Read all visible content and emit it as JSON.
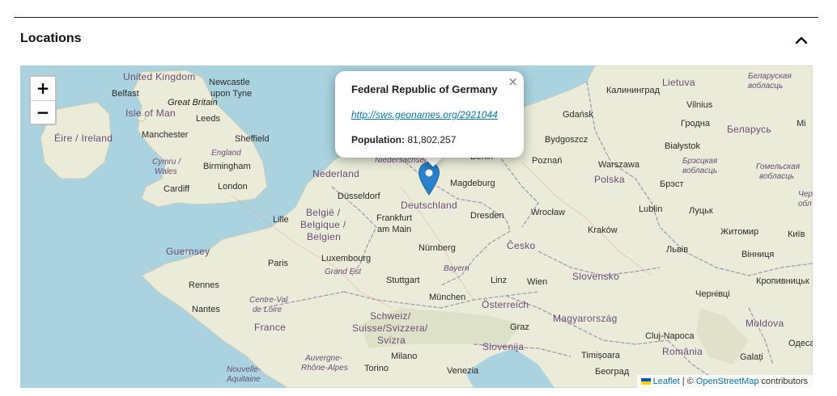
{
  "section": {
    "title": "Locations"
  },
  "zoom": {
    "in_label": "+",
    "out_label": "−"
  },
  "popup": {
    "title": "Federal Republic of Germany",
    "link": "http://sws.geonames.org/2921044",
    "population_label": "Population:",
    "population_value": "81,802,257",
    "close_label": "×"
  },
  "marker": {
    "name": "Germany",
    "icon": "map-marker-icon",
    "color": "#2a81cb"
  },
  "attribution": {
    "leaflet": "Leaflet",
    "separator": " | © ",
    "osm": "OpenStreetMap",
    "suffix": " contributors"
  },
  "colors": {
    "sea": "#aad3df",
    "land": "#eaecd9",
    "link": "#0078a8",
    "border": "#9b7fa8"
  },
  "map_labels": [
    {
      "id": "united-kingdom",
      "text": "United Kingdom",
      "kind": "country"
    },
    {
      "id": "newcastle",
      "text": "Newcastle",
      "kind": "city"
    },
    {
      "id": "upon-tyne",
      "text": "upon Tyne",
      "kind": "city"
    },
    {
      "id": "belfast",
      "text": "Belfast",
      "kind": "city"
    },
    {
      "id": "great-britain",
      "text": "Great Britain",
      "kind": "island"
    },
    {
      "id": "isle-of-man",
      "text": "Isle of Man",
      "kind": "country"
    },
    {
      "id": "leeds",
      "text": "Leeds",
      "kind": "city"
    },
    {
      "id": "eire-ireland",
      "text": "Éire / Ireland",
      "kind": "country"
    },
    {
      "id": "manchester",
      "text": "Manchester",
      "kind": "city"
    },
    {
      "id": "sheffield",
      "text": "Sheffield",
      "kind": "city"
    },
    {
      "id": "england",
      "text": "England",
      "kind": "region"
    },
    {
      "id": "cymru",
      "text": "Cymru /",
      "kind": "region"
    },
    {
      "id": "wales",
      "text": "Wales",
      "kind": "region"
    },
    {
      "id": "birmingham",
      "text": "Birmingham",
      "kind": "city"
    },
    {
      "id": "cardiff",
      "text": "Cardiff",
      "kind": "city"
    },
    {
      "id": "london",
      "text": "London",
      "kind": "city"
    },
    {
      "id": "nederland",
      "text": "Nederland",
      "kind": "country"
    },
    {
      "id": "niedersachsen",
      "text": "Niedersachsen",
      "kind": "region"
    },
    {
      "id": "berlin",
      "text": "Berlin",
      "kind": "city"
    },
    {
      "id": "magdeburg",
      "text": "Magdeburg",
      "kind": "city"
    },
    {
      "id": "dusseldorf",
      "text": "Düsseldorf",
      "kind": "city"
    },
    {
      "id": "deutschland",
      "text": "Deutschland",
      "kind": "country"
    },
    {
      "id": "belgie",
      "text": "België /",
      "kind": "country"
    },
    {
      "id": "belgique",
      "text": "Belgique /",
      "kind": "country"
    },
    {
      "id": "belgien",
      "text": "Belgien",
      "kind": "country"
    },
    {
      "id": "lille",
      "text": "Lille",
      "kind": "city"
    },
    {
      "id": "frankfurt",
      "text": "Frankfurt",
      "kind": "city"
    },
    {
      "id": "am-main",
      "text": "am Main",
      "kind": "city"
    },
    {
      "id": "dresden",
      "text": "Dresden",
      "kind": "city"
    },
    {
      "id": "nurnberg",
      "text": "Nürnberg",
      "kind": "city"
    },
    {
      "id": "guernsey",
      "text": "Guernsey",
      "kind": "country"
    },
    {
      "id": "luxembourg",
      "text": "Luxembourg",
      "kind": "city"
    },
    {
      "id": "paris",
      "text": "Paris",
      "kind": "city"
    },
    {
      "id": "grand-est",
      "text": "Grand Est",
      "kind": "region"
    },
    {
      "id": "bayern",
      "text": "Bayern",
      "kind": "region"
    },
    {
      "id": "stuttgart",
      "text": "Stuttgart",
      "kind": "city"
    },
    {
      "id": "rennes",
      "text": "Rennes",
      "kind": "city"
    },
    {
      "id": "munchen",
      "text": "München",
      "kind": "city"
    },
    {
      "id": "nantes",
      "text": "Nantes",
      "kind": "city"
    },
    {
      "id": "centre-val",
      "text": "Centre-Val",
      "kind": "region"
    },
    {
      "id": "de-loire",
      "text": "de Loire",
      "kind": "region"
    },
    {
      "id": "france",
      "text": "France",
      "kind": "country"
    },
    {
      "id": "schweiz",
      "text": "Schweiz/",
      "kind": "country"
    },
    {
      "id": "suisse",
      "text": "Suisse/Svizzera/",
      "kind": "country"
    },
    {
      "id": "svizra",
      "text": "Svizra",
      "kind": "country"
    },
    {
      "id": "milano",
      "text": "Milano",
      "kind": "city"
    },
    {
      "id": "auvergne",
      "text": "Auvergne-",
      "kind": "region"
    },
    {
      "id": "rhone-alpes",
      "text": "Rhône-Alpes",
      "kind": "region"
    },
    {
      "id": "torino",
      "text": "Torino",
      "kind": "city"
    },
    {
      "id": "nouvelle",
      "text": "Nouvelle-",
      "kind": "region"
    },
    {
      "id": "aquitaine",
      "text": "Aquitaine",
      "kind": "region"
    },
    {
      "id": "venezia",
      "text": "Venezia",
      "kind": "city"
    },
    {
      "id": "gdansk",
      "text": "Gdańsk",
      "kind": "city"
    },
    {
      "id": "kaliningrad",
      "text": "Калининград",
      "kind": "city"
    },
    {
      "id": "bydgoszcz",
      "text": "Bydgoszcz",
      "kind": "city"
    },
    {
      "id": "poznan",
      "text": "Poznań",
      "kind": "city"
    },
    {
      "id": "polska",
      "text": "Polska",
      "kind": "country"
    },
    {
      "id": "warszawa",
      "text": "Warszawa",
      "kind": "city"
    },
    {
      "id": "wroclaw",
      "text": "Wrocław",
      "kind": "city"
    },
    {
      "id": "cesko",
      "text": "Česko",
      "kind": "country"
    },
    {
      "id": "krakow",
      "text": "Kraków",
      "kind": "city"
    },
    {
      "id": "linz",
      "text": "Linz",
      "kind": "city"
    },
    {
      "id": "wien",
      "text": "Wien",
      "kind": "city"
    },
    {
      "id": "slovensko",
      "text": "Slovensko",
      "kind": "country"
    },
    {
      "id": "osterreich",
      "text": "Österreich",
      "kind": "country"
    },
    {
      "id": "graz",
      "text": "Graz",
      "kind": "city"
    },
    {
      "id": "magyarorszag",
      "text": "Magyarország",
      "kind": "country"
    },
    {
      "id": "slovenija",
      "text": "Slovenija",
      "kind": "country"
    },
    {
      "id": "lietuva",
      "text": "Lietuva",
      "kind": "country"
    },
    {
      "id": "belaruskaya",
      "text": "Беларуская",
      "kind": "region"
    },
    {
      "id": "voblasts1",
      "text": "вобласць",
      "kind": "region"
    },
    {
      "id": "vilnius",
      "text": "Vilnius",
      "kind": "city"
    },
    {
      "id": "grodna",
      "text": "Гродна",
      "kind": "city"
    },
    {
      "id": "mi",
      "text": "Мі",
      "kind": "city"
    },
    {
      "id": "belarus",
      "text": "Беларусь",
      "kind": "country"
    },
    {
      "id": "bialystok",
      "text": "Białystok",
      "kind": "city"
    },
    {
      "id": "brestskaya",
      "text": "Брэсцкая",
      "kind": "region"
    },
    {
      "id": "voblasts2",
      "text": "вобласць",
      "kind": "region"
    },
    {
      "id": "homelskaya",
      "text": "Гомельская",
      "kind": "region"
    },
    {
      "id": "voblasts3",
      "text": "вобласць",
      "kind": "region"
    },
    {
      "id": "brest",
      "text": "Брэст",
      "kind": "city"
    },
    {
      "id": "cher",
      "text": "Чер",
      "kind": "region"
    },
    {
      "id": "obl",
      "text": "обл",
      "kind": "region"
    },
    {
      "id": "lublin",
      "text": "Lublin",
      "kind": "city"
    },
    {
      "id": "lutsk",
      "text": "Луцьк",
      "kind": "city"
    },
    {
      "id": "zhytomyr",
      "text": "Житомир",
      "kind": "city"
    },
    {
      "id": "kyiv",
      "text": "Київ",
      "kind": "city"
    },
    {
      "id": "lviv",
      "text": "Львів",
      "kind": "city"
    },
    {
      "id": "vinnytsia",
      "text": "Вінниця",
      "kind": "city"
    },
    {
      "id": "kropyvnytskyi",
      "text": "Кропивницьк",
      "kind": "city"
    },
    {
      "id": "chernivtsi",
      "text": "Чернівці",
      "kind": "city"
    },
    {
      "id": "moldova",
      "text": "Moldova",
      "kind": "country"
    },
    {
      "id": "cluj-napoca",
      "text": "Cluj-Napoca",
      "kind": "city"
    },
    {
      "id": "odesa",
      "text": "Одеса",
      "kind": "city"
    },
    {
      "id": "romania",
      "text": "România",
      "kind": "country"
    },
    {
      "id": "timisoara",
      "text": "Timișoara",
      "kind": "city"
    },
    {
      "id": "galati",
      "text": "Galați",
      "kind": "city"
    },
    {
      "id": "beograd",
      "text": "Београд",
      "kind": "city"
    }
  ]
}
